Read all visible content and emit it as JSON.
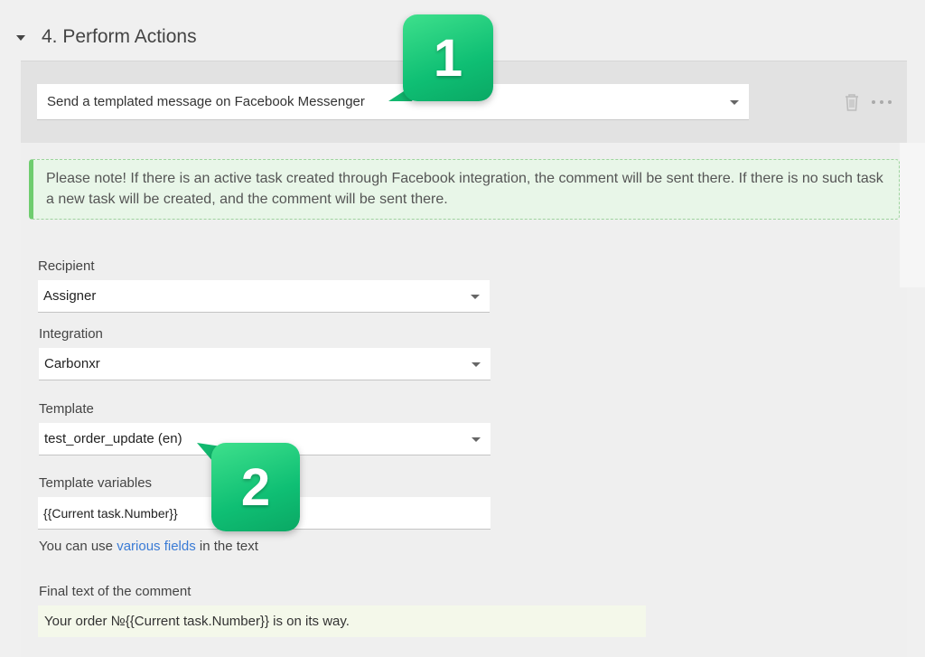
{
  "section": {
    "title": "4. Perform Actions"
  },
  "action": {
    "selected": "Send a templated message on Facebook Messenger"
  },
  "note": {
    "text": "Please note! If there is an active task created through Facebook integration, the comment will be sent there. If there is no such task a new task will be created, and the comment will be sent there."
  },
  "fields": {
    "recipient": {
      "label": "Recipient",
      "value": "Assigner"
    },
    "integration": {
      "label": "Integration",
      "value": "Carbonxr"
    },
    "template": {
      "label": "Template",
      "value": "test_order_update (en)"
    },
    "variables": {
      "label": "Template variables",
      "value": "{{Current task.Number}}"
    }
  },
  "hint": {
    "prefix": "You can use ",
    "link": "various fields",
    "suffix": " in the text"
  },
  "final": {
    "label": "Final text of the comment",
    "value": "Your order №{{Current task.Number}} is on its way."
  },
  "callouts": {
    "one": "1",
    "two": "2"
  },
  "icons": {
    "trash": "trash-icon",
    "more": "more-icon",
    "collapse": "caret-down-icon",
    "dropdown": "chevron-down-icon"
  },
  "colors": {
    "accent_green": "#12c278",
    "note_bg": "#e8f6e8",
    "note_border": "#6fcd6f",
    "link": "#3a7bd5"
  }
}
